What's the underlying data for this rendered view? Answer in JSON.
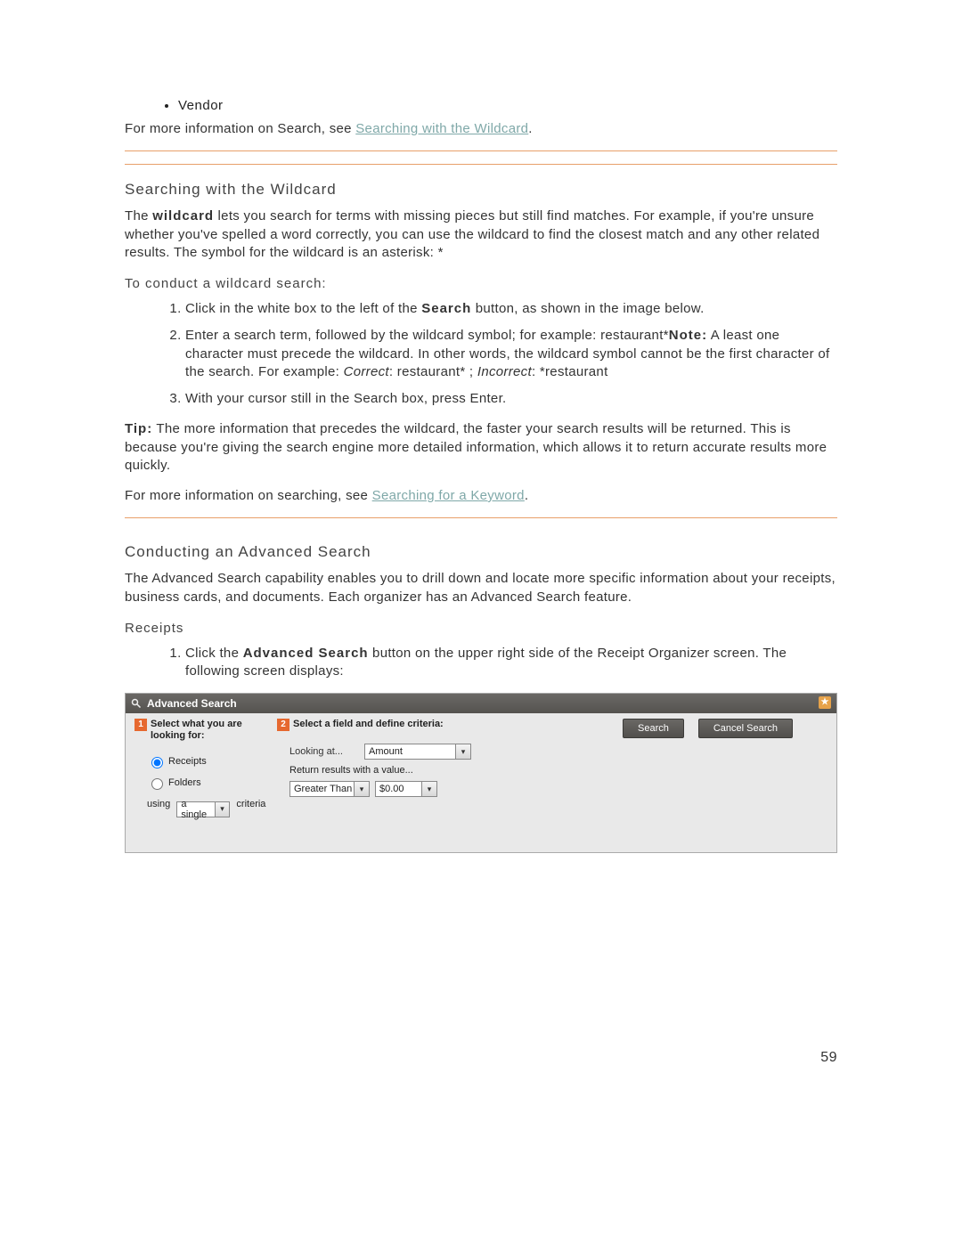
{
  "top": {
    "bullet_item": "Vendor",
    "info_prefix": "For more information on Search, see ",
    "info_link": "Searching with the Wildcard",
    "info_suffix": "."
  },
  "wildcard": {
    "heading": "Searching with the Wildcard",
    "para_prefix": "The ",
    "para_bold": "wildcard",
    "para_rest": " lets you search for terms with missing pieces but still find matches. For example, if you're unsure whether you've spelled a word correctly, you can use the wildcard to find the closest match and any other related results. The symbol for the wildcard is an asterisk: *",
    "sub_heading": "To conduct a wildcard search:",
    "steps": {
      "s1_a": "Click in the white box to the left of the ",
      "s1_b": "Search",
      "s1_c": " button, as shown in the image below.",
      "s2_a": "Enter a search term, followed by the wildcard symbol; for example: restaurant*",
      "s2_note_label": "Note:",
      "s2_b": " A least one character must precede the wildcard. In other words, the wildcard symbol cannot be the first character of the search. For example: ",
      "s2_correct_lbl": "Correct",
      "s2_correct_val": ": restaurant* ; ",
      "s2_incorrect_lbl": "Incorrect",
      "s2_incorrect_val": ": *restaurant",
      "s3": "With your cursor still in the Search box, press Enter."
    },
    "tip_label": "Tip:",
    "tip_text": " The more information that precedes the wildcard, the faster your search results will be returned. This is because you're giving the search engine more detailed information, which allows it to return accurate results more quickly.",
    "more_prefix": "For more information on searching, see ",
    "more_link": "Searching for a Keyword",
    "more_suffix": "."
  },
  "advanced": {
    "heading": "Conducting an Advanced Search",
    "intro": "The Advanced Search capability enables you to drill down and locate more specific information about your receipts, business cards, and documents. Each organizer has an Advanced Search feature.",
    "sub_heading": "Receipts",
    "step1_a": "Click the ",
    "step1_b": "Advanced Search",
    "step1_c": " button on the upper right side of the Receipt Organizer screen. The following screen displays:"
  },
  "ui": {
    "title": "Advanced Search",
    "step1_badge": "1",
    "step1_label": "Select what you are looking for:",
    "radio_receipts": "Receipts",
    "radio_folders": "Folders",
    "using_prefix": "using",
    "using_select": "a single",
    "using_suffix": "criteria",
    "step2_badge": "2",
    "step2_label": "Select a field and define criteria:",
    "looking_at": "Looking at...",
    "looking_at_value": "Amount",
    "return_lbl": "Return results with a value...",
    "op_select": "Greater Than",
    "value_input": "$0.00",
    "btn_search": "Search",
    "btn_cancel": "Cancel Search"
  },
  "page_number": "59"
}
